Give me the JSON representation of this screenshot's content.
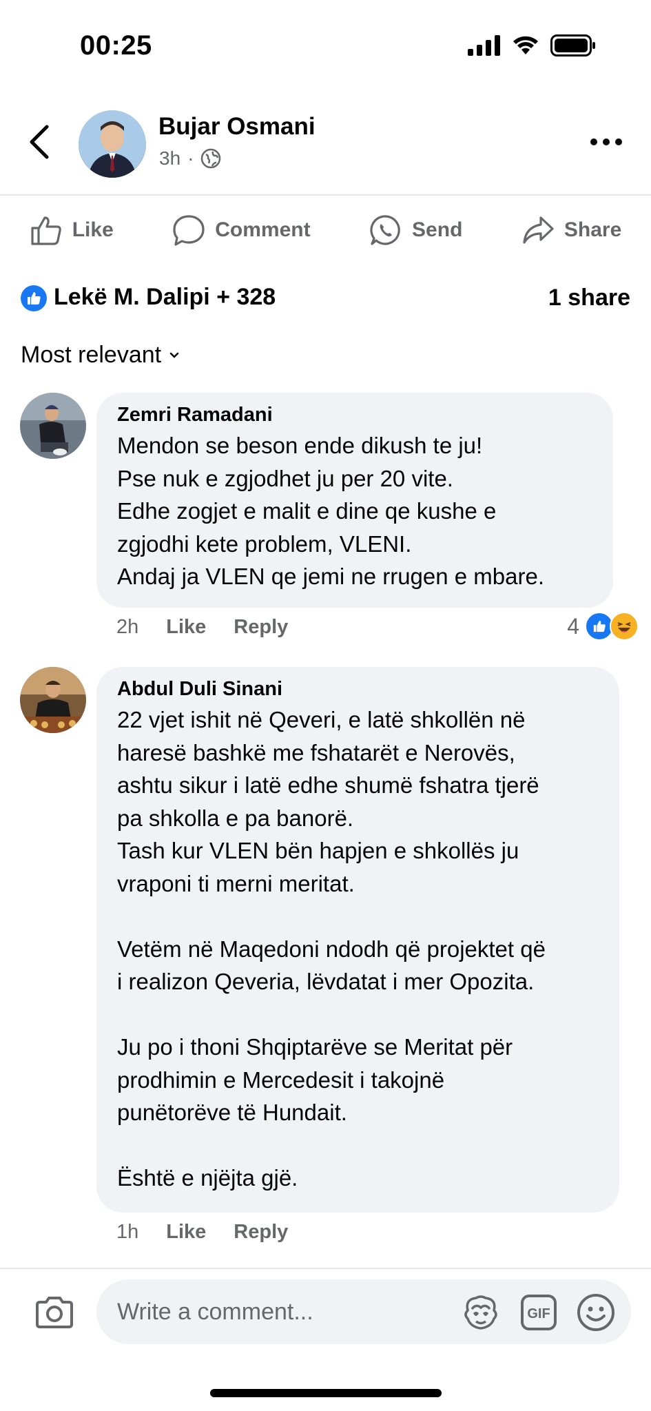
{
  "status": {
    "time": "00:25"
  },
  "post": {
    "author": "Bujar Osmani",
    "time": "3h",
    "separator": "·"
  },
  "actions": [
    {
      "label": "Like",
      "icon": "thumbs-up-icon"
    },
    {
      "label": "Comment",
      "icon": "comment-icon"
    },
    {
      "label": "Send",
      "icon": "whatsapp-icon"
    },
    {
      "label": "Share",
      "icon": "share-icon"
    }
  ],
  "reactions": {
    "summary": "Lekë M. Dalipi + 328",
    "shares": "1 share"
  },
  "sort": {
    "label": "Most relevant"
  },
  "comments": [
    {
      "name": "Zemri Ramadani",
      "text": "Mendon se beson ende dikush te ju!\nPse nuk e zgjodhet ju per 20 vite.\nEdhe zogjet e malit e dine qe kushe e\nzgjodhi kete problem, VLENI.\nAndaj ja VLEN  qe jemi ne rrugen e mbare.",
      "time": "2h",
      "like": "Like",
      "reply": "Reply",
      "reaction_count": "4"
    },
    {
      "name": "Abdul Duli Sinani",
      "text": "22 vjet ishit në Qeveri, e latë shkollën në\nharesë bashkë me fshatarët e Nerovës,\nashtu sikur i latë edhe shumë fshatra tjerë\npa shkolla e pa banorë.\nTash kur VLEN bën hapjen e shkollës ju\nvraponi ti merni meritat.\n\nVetëm në Maqedoni ndodh që projektet që\ni realizon Qeveria, lëvdatat i mer Opozita.\n\nJu po i thoni Shqiptarëve se Meritat për\nprodhimin e Mercedesit i takojnë\npunëtorëve të Hundait.\n\nËshtë e njëjta gjë.",
      "time": "1h",
      "like": "Like",
      "reply": "Reply"
    }
  ],
  "composer": {
    "placeholder": "Write a comment..."
  },
  "colors": {
    "accent": "#1877f2",
    "muted": "#65676b",
    "bubble": "#f0f2f5"
  }
}
